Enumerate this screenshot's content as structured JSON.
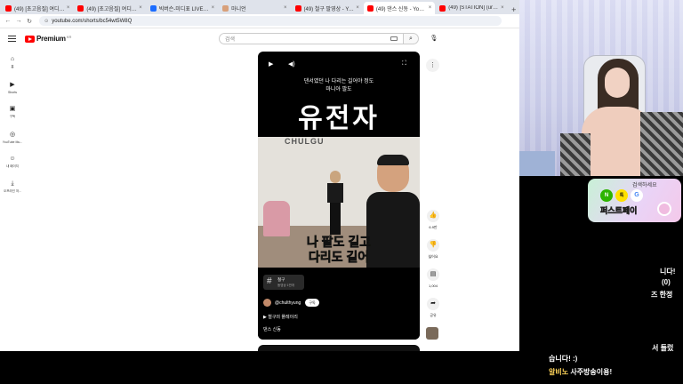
{
  "browser": {
    "tabs": [
      {
        "title": "(49) [초고음질] 여디선이그포]",
        "color": "#ff0000"
      },
      {
        "title": "(49) [초고음질] 여디선이그포]",
        "color": "#ff0000"
      },
      {
        "title": "빅버슨-미디표 LIVE - SOOP",
        "color": "#1b6cff"
      },
      {
        "title": "마니언",
        "color": "#d8a07a"
      },
      {
        "title": "(49) 철구 팔영상 - YouTube",
        "color": "#ff0000"
      },
      {
        "title": "(49) 댄스 신동 - YouTube",
        "color": "#ff0000",
        "active": true
      },
      {
        "title": "(49) [STATION] (urces n acl",
        "color": "#ff0000"
      }
    ],
    "new_tab": "+",
    "url": "youtube.com/shorts/bc54wt5W8Q"
  },
  "youtube": {
    "logo_text": "Premium",
    "logo_country": "KR",
    "search_placeholder": "검색",
    "sidebar": [
      {
        "icon": "home-icon",
        "glyph": "⌂",
        "label": "홈"
      },
      {
        "icon": "shorts-icon",
        "glyph": "▶",
        "label": "Shorts"
      },
      {
        "icon": "subscriptions-icon",
        "glyph": "▣",
        "label": "구독"
      },
      {
        "icon": "youtube-music-icon",
        "glyph": "◎",
        "label": "YouTube Mu..."
      },
      {
        "icon": "you-icon",
        "glyph": "☺",
        "label": "내 페이지"
      },
      {
        "icon": "download-icon",
        "glyph": "⤓",
        "label": "오프라인 저..."
      }
    ],
    "short": {
      "caption_line1": "댄서였던 나 다리는 길어야 정도",
      "caption_line2": "마니아 팔도",
      "big_title": "유전자",
      "wall_brand": "CHULGU",
      "subtitle_line1": "나 팔도 길고",
      "subtitle_line2": "다리도 길어",
      "hashtag_chip_title": "철구",
      "hashtag_chip_sub": "동영상 1만개",
      "channel": "@chulthyung",
      "subscribe": "구독",
      "playlist": "철구의 플레이리",
      "description": "댄스 신동"
    },
    "actions": [
      {
        "icon": "like-icon",
        "glyph": "👍",
        "label": "6.9만"
      },
      {
        "icon": "dislike-icon",
        "glyph": "👎",
        "label": "싫어요"
      },
      {
        "icon": "comment-icon",
        "glyph": "▤",
        "label": "1,004"
      },
      {
        "icon": "share-icon",
        "glyph": "➦",
        "label": "공유"
      }
    ],
    "more": "⋮"
  },
  "ad": {
    "top_text": "검색하세요",
    "brand": "퍼스트페이",
    "logo1": "N",
    "logo2": "톡",
    "logo3": "G"
  },
  "chat": {
    "line1": "니다!",
    "line2": "(0)",
    "line3": "즈 한정",
    "line4": "서 들렀",
    "line5": "습니다! :)",
    "nick": "알비노",
    "line6_msg": "사주방송이용!"
  }
}
